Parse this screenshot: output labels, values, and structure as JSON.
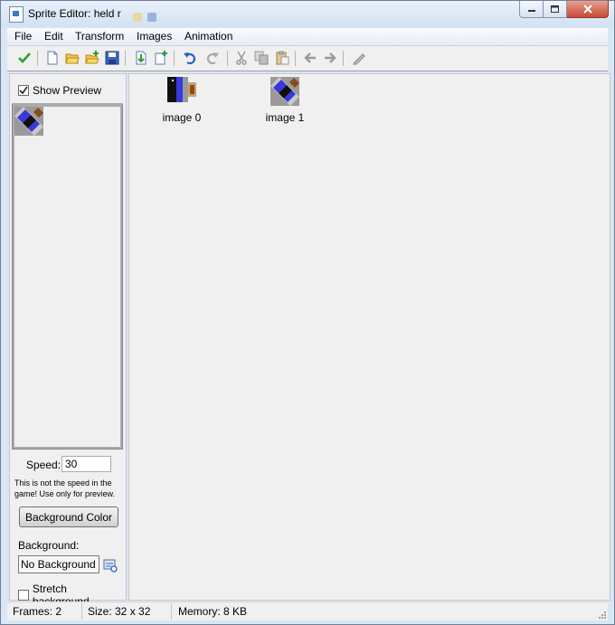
{
  "window": {
    "title": "Sprite Editor: held r"
  },
  "menu": [
    "File",
    "Edit",
    "Transform",
    "Images",
    "Animation"
  ],
  "toolbar": {
    "icons": [
      "checkmark-icon",
      "new-document-icon",
      "open-folder-icon",
      "open-folder-add-icon",
      "save-icon",
      "import-icon",
      "add-image-icon",
      "undo-icon",
      "redo-icon",
      "cut-icon",
      "copy-icon",
      "paste-icon",
      "arrow-left-icon",
      "arrow-right-icon",
      "pencil-icon"
    ]
  },
  "left_panel": {
    "show_preview_label": "Show Preview",
    "show_preview_checked": true,
    "speed_label": "Speed:",
    "speed_value": "30",
    "speed_note": "This is not the speed in the game! Use only for preview.",
    "background_color_button": "Background Color",
    "background_label": "Background:",
    "background_value": "No Background",
    "stretch_label": "Stretch background",
    "stretch_checked": false
  },
  "frames": [
    {
      "label": "image 0"
    },
    {
      "label": "image 1"
    }
  ],
  "status": {
    "frames": "Frames: 2",
    "size": "Size: 32 x 32",
    "memory": "Memory: 8 KB"
  },
  "colors": {
    "sprite_blue": "#3838e0",
    "sprite_black": "#101010",
    "sprite_gray": "#9a9a9a",
    "sprite_brown": "#8a4a1c"
  }
}
